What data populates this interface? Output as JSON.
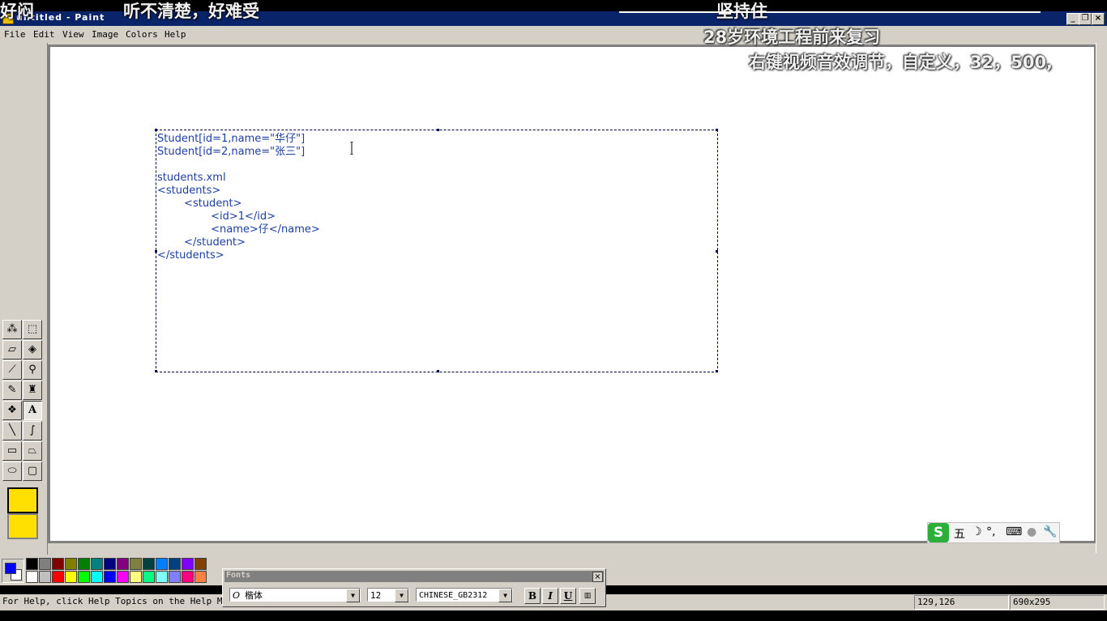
{
  "window": {
    "title": "untitled - Paint"
  },
  "menu": [
    "File",
    "Edit",
    "View",
    "Image",
    "Colors",
    "Help"
  ],
  "overlay": {
    "danmaku": [
      {
        "text": "好闷"
      },
      {
        "text": "听不清楚，好难受"
      },
      {
        "text": "坚持住"
      },
      {
        "text": "28岁环境工程前来复习"
      },
      {
        "text": "右键视频音效调节，自定义，32，500,"
      }
    ]
  },
  "canvas_text": {
    "lines": [
      "Student[id=1,name=\"华仔\"]",
      "Student[id=2,name=\"张三\"]",
      "",
      "students.xml",
      "<students>",
      "        <student>",
      "                <id>1</id>",
      "                <name>仔</name>",
      "        </student>",
      "</students>"
    ]
  },
  "ime": {
    "mode": "五",
    "logo": "S",
    "punct": "°,"
  },
  "fonts_toolbar": {
    "title": "Fonts",
    "font_name": "楷体",
    "font_size": "12",
    "script": "CHINESE_GB2312",
    "bold": "B",
    "italic": "I",
    "underline": "U",
    "close": "×"
  },
  "status": {
    "help": "For Help, click Help Topics on the Help Menu.",
    "coords": "129,126",
    "size": "690x295"
  },
  "colors": {
    "foreground": "#0000ff",
    "background": "#ffffff",
    "palette_top": [
      "#000000",
      "#808080",
      "#800000",
      "#808000",
      "#008000",
      "#008080",
      "#000080",
      "#800080",
      "#808040",
      "#004040",
      "#0080ff",
      "#004080",
      "#8000ff",
      "#804000"
    ],
    "palette_bottom": [
      "#ffffff",
      "#c0c0c0",
      "#ff0000",
      "#ffff00",
      "#00ff00",
      "#00ffff",
      "#0000ff",
      "#ff00ff",
      "#ffff80",
      "#00ff80",
      "#80ffff",
      "#8080ff",
      "#ff0080",
      "#ff8040"
    ]
  }
}
